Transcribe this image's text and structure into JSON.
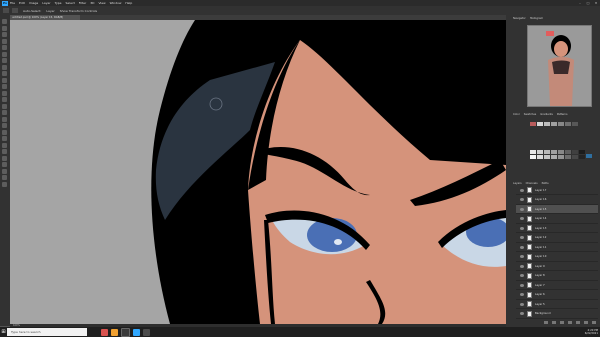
{
  "menubar": {
    "app_logo": "Ps",
    "items": [
      "File",
      "Edit",
      "Image",
      "Layer",
      "Type",
      "Select",
      "Filter",
      "3D",
      "View",
      "Window",
      "Help"
    ]
  },
  "optbar": {
    "items": [
      "Auto-Select:",
      "Layer",
      "Show Transform Controls"
    ]
  },
  "document_tab": {
    "label": "untitled.psd @ 100% (Layer 15, RGB/8)"
  },
  "statusbar": {
    "zoom": "100%"
  },
  "panels": {
    "top_tabs": [
      "Navigator",
      "Histogram"
    ],
    "swatch_tabs": [
      "Color",
      "Swatches",
      "Gradients",
      "Patterns"
    ],
    "layer_tabs": [
      "Layers",
      "Channels",
      "Paths"
    ]
  },
  "layers": [
    {
      "name": "Layer 17"
    },
    {
      "name": "Layer 16"
    },
    {
      "name": "Layer 15"
    },
    {
      "name": "Layer 14"
    },
    {
      "name": "Layer 13"
    },
    {
      "name": "Layer 12"
    },
    {
      "name": "Layer 11"
    },
    {
      "name": "Layer 10"
    },
    {
      "name": "Layer 9"
    },
    {
      "name": "Layer 8"
    },
    {
      "name": "Layer 7"
    },
    {
      "name": "Layer 6"
    },
    {
      "name": "Layer 5"
    },
    {
      "name": "Background"
    }
  ],
  "taskbar": {
    "search_placeholder": "Type here to search",
    "time": "4:20 PM",
    "date": "6/22/2021"
  },
  "colors": {
    "skin": "#d5937b",
    "hair": "#000000",
    "hair_highlight": "#2a3440",
    "iris": "#4a6fb5",
    "eye_white": "#c9d7e6",
    "canvas_bg": "#a5a5a5"
  }
}
